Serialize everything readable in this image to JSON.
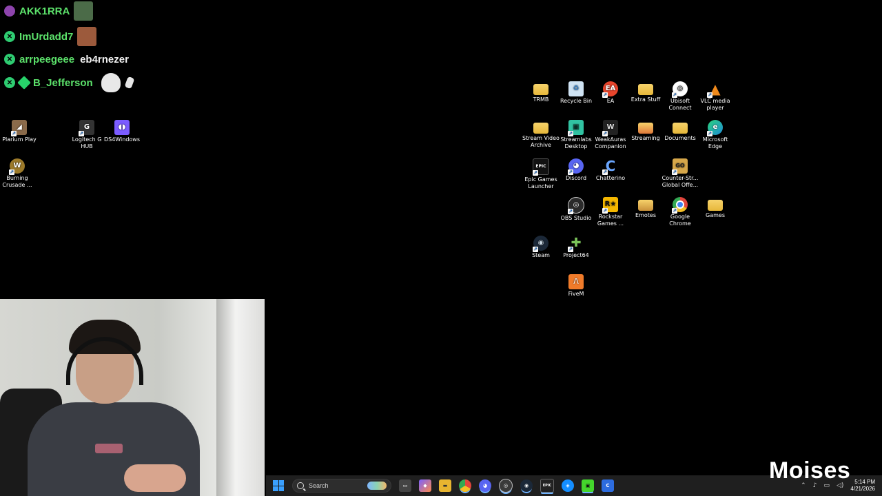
{
  "chat": [
    {
      "user": "AKK1RRA",
      "badge": "purple",
      "extra": ""
    },
    {
      "user": "ImUrdadd7",
      "badge": "green",
      "extra": ""
    },
    {
      "user": "arrpeegeee",
      "badge": "green",
      "extra": "eb4rnezer"
    },
    {
      "user": "B_Jefferson",
      "badge": "green",
      "extra": ""
    }
  ],
  "desktop_left": [
    {
      "label": "Plarium Play",
      "icon": "plarium-icon",
      "color": "#8a6a4a"
    },
    {
      "label": "Logitech G HUB",
      "icon": "logitech-icon",
      "color": "#333333"
    },
    {
      "label": "DS4Windows",
      "icon": "gamepad-icon",
      "color": "#7b5cff"
    },
    {
      "label": "Burning Crusade ...",
      "icon": "wow-icon",
      "color": "#9c7a2a"
    }
  ],
  "desktop_right": [
    {
      "label": "TRMB",
      "icon": "folder-icon",
      "color": "#f2c94c"
    },
    {
      "label": "Recycle Bin",
      "icon": "recycle-bin-icon",
      "color": "#9fc8ea"
    },
    {
      "label": "EA",
      "icon": "ea-icon",
      "color": "#e8452c"
    },
    {
      "label": "Extra Stuff",
      "icon": "folder-icon",
      "color": "#f2c94c"
    },
    {
      "label": "Ubisoft Connect",
      "icon": "ubisoft-icon",
      "color": "#2b2b2b"
    },
    {
      "label": "VLC media player",
      "icon": "vlc-icon",
      "color": "#f08a1c"
    },
    {
      "label": "Stream Video Archive",
      "icon": "folder-icon",
      "color": "#f2c94c"
    },
    {
      "label": "Streamlabs Desktop",
      "icon": "streamlabs-icon",
      "color": "#31c3a2"
    },
    {
      "label": "WeakAuras Companion",
      "icon": "weakauras-icon",
      "color": "#222222"
    },
    {
      "label": "Streaming",
      "icon": "folder-icon",
      "color": "#f2c94c"
    },
    {
      "label": "Documents",
      "icon": "folder-icon",
      "color": "#f2c94c"
    },
    {
      "label": "Microsoft Edge",
      "icon": "edge-icon",
      "color": "#1e8fd8"
    },
    {
      "label": "Epic Games Launcher",
      "icon": "epic-icon",
      "color": "#111111"
    },
    {
      "label": "Discord",
      "icon": "discord-icon",
      "color": "#5865f2"
    },
    {
      "label": "Chatterino",
      "icon": "chatterino-icon",
      "color": "#6aa6ff"
    },
    {
      "label": "Counter-Str... Global Offe...",
      "icon": "csgo-icon",
      "color": "#d6a74a"
    },
    {
      "label": "OBS Studio",
      "icon": "obs-icon",
      "color": "#2b2b2b"
    },
    {
      "label": "Rockstar Games ...",
      "icon": "rockstar-icon",
      "color": "#f5b800"
    },
    {
      "label": "Emotes",
      "icon": "folder-icon",
      "color": "#f2c94c"
    },
    {
      "label": "Google Chrome",
      "icon": "chrome-icon",
      "color": "#e2453c"
    },
    {
      "label": "Games",
      "icon": "folder-icon",
      "color": "#f2c94c"
    },
    {
      "label": "Steam",
      "icon": "steam-icon",
      "color": "#1b2838"
    },
    {
      "label": "Project64",
      "icon": "project64-icon",
      "color": "#5aa845"
    },
    {
      "label": "FiveM",
      "icon": "fivem-icon",
      "color": "#f07b2a"
    }
  ],
  "taskbar": {
    "search_placeholder": "Search",
    "apps": [
      {
        "name": "taskview",
        "glyph": "▭",
        "color": "#444444"
      },
      {
        "name": "copilot",
        "glyph": "◆",
        "color": "#7b61ff"
      },
      {
        "name": "file-explorer",
        "glyph": "▬",
        "color": "#e8b530"
      },
      {
        "name": "chrome",
        "glyph": "●",
        "color": "#e2453c"
      },
      {
        "name": "discord",
        "glyph": "◕",
        "color": "#5865f2"
      },
      {
        "name": "obs",
        "glyph": "◎",
        "color": "#3a3a3a"
      },
      {
        "name": "steam",
        "glyph": "◉",
        "color": "#1b2838"
      },
      {
        "name": "epic",
        "glyph": "EPIC",
        "color": "#222222"
      },
      {
        "name": "battlenet",
        "glyph": "◈",
        "color": "#148eff"
      },
      {
        "name": "razer",
        "glyph": "▣",
        "color": "#44d62c"
      },
      {
        "name": "chatterino",
        "glyph": "C",
        "color": "#2d6cdf"
      }
    ],
    "time": "5:14 PM",
    "date": "4/21/2026"
  },
  "watermark": "Moises"
}
